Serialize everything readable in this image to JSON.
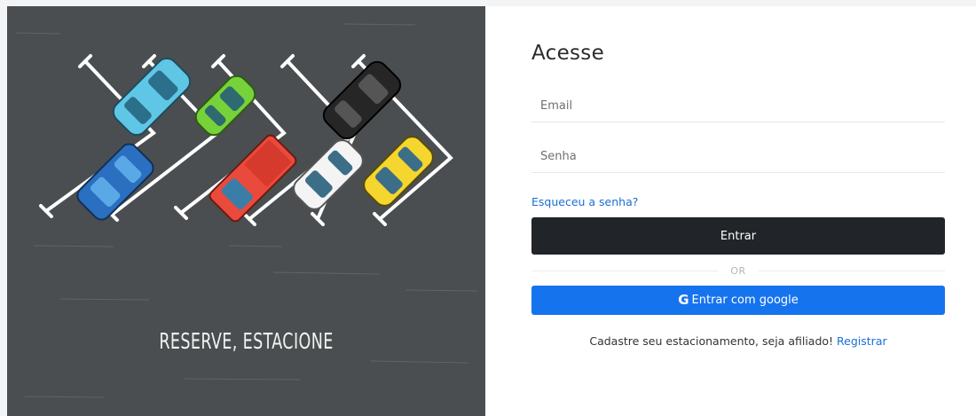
{
  "hero": {
    "caption": "RESERVE, ESTACIONE"
  },
  "login": {
    "title": "Acesse",
    "email_placeholder": "Email",
    "password_placeholder": "Senha",
    "forgot_link": "Esqueceu a senha?",
    "submit_label": "Entrar",
    "divider_text": "OR",
    "google_icon": "G",
    "google_label": "Entrar com google",
    "signup_text": "Cadastre seu estacionamento, seja afiliado!",
    "signup_link": "Registrar"
  },
  "colors": {
    "hero_background": "#4a4e50",
    "dark_button": "#212529",
    "google_button": "#1673ee",
    "link": "#1a6fd6"
  }
}
